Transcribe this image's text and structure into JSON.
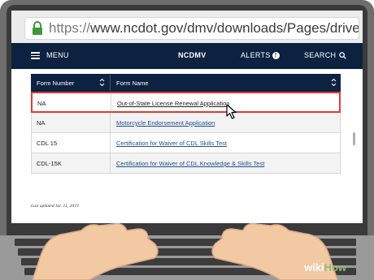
{
  "browser": {
    "url_protocol": "https://",
    "url_rest": "www.ncdot.gov/dmv/downloads/Pages/driver-license.aspx"
  },
  "nav": {
    "menu_label": "MENU",
    "brand": "NCDMV",
    "alerts_label": "ALERTS",
    "alerts_count": "!",
    "search_label": "SEARCH"
  },
  "table": {
    "headers": [
      "Form Number",
      "Form Name"
    ],
    "rows": [
      {
        "number": "NA",
        "name": "Out-of-State License Renewal Application"
      },
      {
        "number": "NA",
        "name": "Motorcycle Endorsement Application"
      },
      {
        "number": "CDL 15",
        "name": "Certification for Waiver of CDL Skills Test"
      },
      {
        "number": "CDL-15K",
        "name": "Certification for Waiver of CDL Knowledge & Skills Test"
      }
    ]
  },
  "footer": {
    "last_updated": "Last updated Jul. 21, 2019"
  },
  "watermark": {
    "part1": "wiki",
    "part2": "How"
  },
  "colors": {
    "nav_bg": "#0d2240",
    "highlight_border": "#e03a3a",
    "link": "#1f4f8f",
    "lock": "#3a9a3a"
  }
}
